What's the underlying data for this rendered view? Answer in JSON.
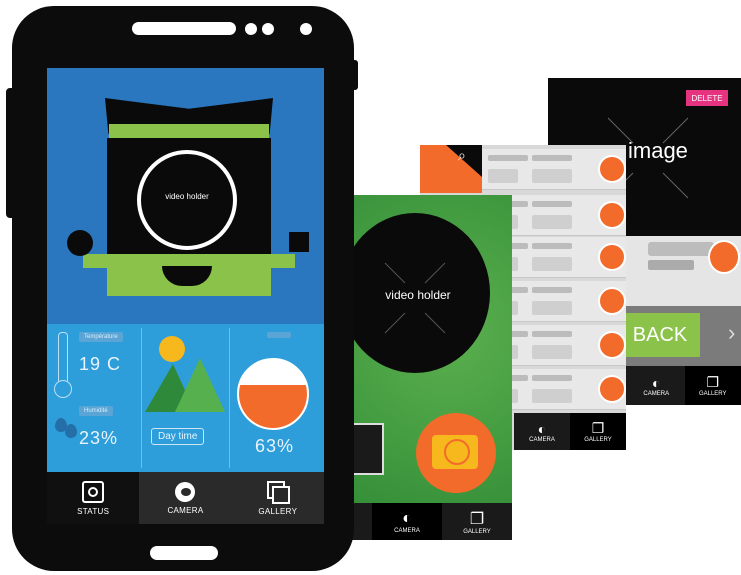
{
  "main_screen": {
    "video_label": "video holder",
    "temperature": {
      "tag": "Température",
      "value": "19 C"
    },
    "humidity": {
      "tag": "Humidité",
      "value": "23%"
    },
    "day_label": "Day time",
    "tank": {
      "tag": "",
      "value": "63%"
    },
    "tabs": [
      {
        "label": "STATUS",
        "icon": "robot-icon"
      },
      {
        "label": "CAMERA",
        "icon": "camera-lens-icon"
      },
      {
        "label": "GALLERY",
        "icon": "gallery-stack-icon"
      }
    ]
  },
  "camera_screen": {
    "video_label": "video holder",
    "tabs": [
      {
        "label": "CAMERA"
      },
      {
        "label": "GALLERY"
      }
    ]
  },
  "gallery_screen": {
    "tabs": [
      {
        "label": "CAMERA"
      },
      {
        "label": "GALLERY"
      }
    ]
  },
  "image_screen": {
    "delete_label": "DELETE",
    "image_label": "image",
    "back_label": "BACK",
    "tabs": [
      {
        "label": "CAMERA"
      },
      {
        "label": "GALLERY"
      }
    ]
  },
  "colors": {
    "hero_blue": "#2a76bf",
    "panel_blue": "#2e9edb",
    "accent_green": "#8bc34a",
    "accent_orange": "#f26b2a",
    "accent_yellow": "#f6b81c",
    "delete_pink": "#e5337f"
  }
}
